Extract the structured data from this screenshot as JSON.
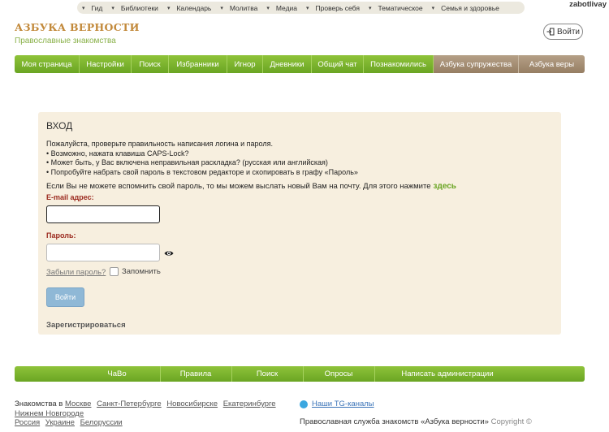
{
  "topbar": {
    "items": [
      "Гид",
      "Библиотеки",
      "Календарь",
      "Молитва",
      "Медиа",
      "Проверь себя",
      "Тематическое",
      "Семья и здоровье"
    ]
  },
  "user": {
    "name": "zabotlivay"
  },
  "header": {
    "logo_title": "АЗБУКА ВЕРНОСТИ",
    "logo_subtitle": "Православные знакомства",
    "login_label": "Войти"
  },
  "nav": {
    "items": [
      "Моя страница",
      "Настройки",
      "Поиск",
      "Избранники",
      "Игнор",
      "Дневники",
      "Общий чат",
      "Познакомились",
      "Азбука супружества",
      "Азбука веры"
    ]
  },
  "login": {
    "title": "ВХОД",
    "intro": "Пожалуйста, проверьте правильность написания логина и пароля.",
    "tips": [
      "Возможно, нажата клавиша CAPS-Lock?",
      "Может быть, у Вас включена неправильная раскладка? (русская или английская)",
      "Попробуйте набрать свой пароль в текстовом редакторе и скопировать в графу «Пароль»"
    ],
    "forgot_text": "Если Вы не можете вспомнить свой пароль, то мы можем выслать новый Вам на почту. Для этого нажмите",
    "here_link": "здесь",
    "email_label": "E-mail адрес:",
    "email_value": "",
    "password_label": "Пароль:",
    "password_value": "",
    "forgot_link": "Забыли пароль?",
    "remember_label": "Запомнить",
    "submit_label": "Войти",
    "register_link": "Зарегистрироваться"
  },
  "footer_nav": {
    "items": [
      "ЧаВо",
      "Правила",
      "Поиск",
      "Опросы",
      "Написать администрации"
    ]
  },
  "footer": {
    "cities_label": "Знакомства в",
    "cities": [
      "Москве",
      "Санкт-Петербурге",
      "Новосибирске",
      "Екатеринбурге",
      "Нижнем Новгороде",
      "Россия",
      "Украине",
      "Белоруссии"
    ],
    "tg_link": "Наши TG-каналы",
    "copyright_text": "Православная служба знакомств «Азбука верности»",
    "copyright_link": "Copyright ©"
  },
  "colors": {
    "nav_green": "#7ab42e",
    "nav_brown": "#a58f74",
    "panel_bg": "#f7efdf",
    "label_red": "#9b2a1f",
    "logo_gold": "#c2893a"
  }
}
